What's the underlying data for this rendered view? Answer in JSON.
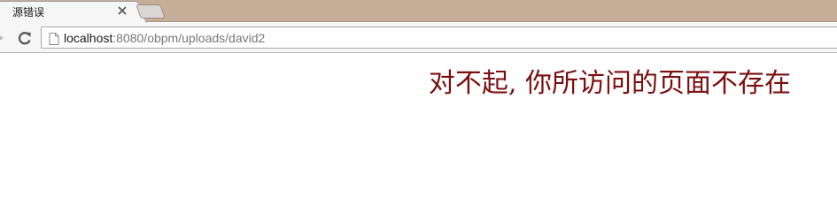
{
  "tab": {
    "title": "源错误",
    "close_icon": "close-icon",
    "new_tab_icon": "new-tab-icon"
  },
  "toolbar": {
    "forward_icon": "forward-arrow-icon",
    "reload_icon": "reload-icon",
    "page_icon": "page-icon"
  },
  "address_bar": {
    "host": "localhost",
    "rest": ":8080/obpm/uploads/david2"
  },
  "page": {
    "message": "对不起, 你所访问的页面不存在"
  },
  "colors": {
    "tabstrip_bg": "#c5ad98",
    "message_color": "#7b0f0f"
  }
}
